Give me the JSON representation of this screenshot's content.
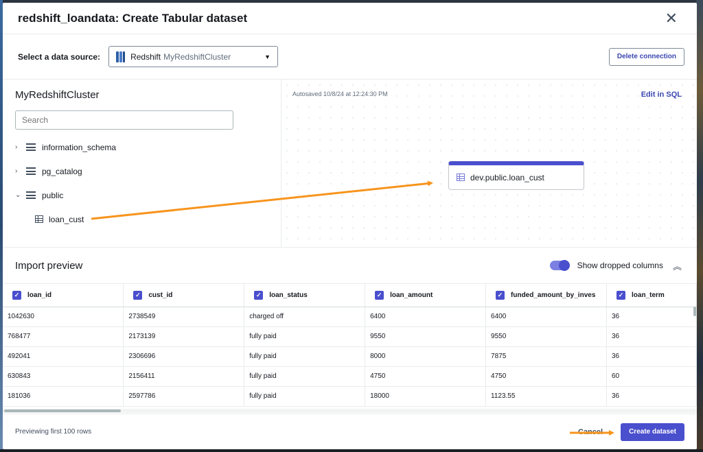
{
  "dialog": {
    "title": "redshift_loandata: Create Tabular dataset",
    "close_symbol": "✕"
  },
  "source": {
    "label": "Select a data source:",
    "selected_name": "Redshift",
    "selected_cluster": "MyRedshiftCluster",
    "delete_label": "Delete connection"
  },
  "explorer": {
    "cluster_title": "MyRedshiftCluster",
    "search_placeholder": "Search",
    "schemas": [
      {
        "label": "information_schema",
        "expanded": false
      },
      {
        "label": "pg_catalog",
        "expanded": false
      },
      {
        "label": "public",
        "expanded": true
      }
    ],
    "tables": [
      {
        "label": "loan_cust"
      }
    ]
  },
  "canvas": {
    "autosave": "Autosaved 10/8/24 at 12:24:30 PM",
    "edit_sql": "Edit in SQL",
    "node_label": "dev.public.loan_cust"
  },
  "preview": {
    "title": "Import preview",
    "toggle_label": "Show dropped columns",
    "toggle_on": true,
    "columns": [
      "loan_id",
      "cust_id",
      "loan_status",
      "loan_amount",
      "funded_amount_by_inves",
      "loan_term"
    ],
    "rows": [
      [
        "1042630",
        "2738549",
        "charged off",
        "6400",
        "6400",
        "36"
      ],
      [
        "768477",
        "2173139",
        "fully paid",
        "9550",
        "9550",
        "36"
      ],
      [
        "492041",
        "2306696",
        "fully paid",
        "8000",
        "7875",
        "36"
      ],
      [
        "630843",
        "2156411",
        "fully paid",
        "4750",
        "4750",
        "60"
      ],
      [
        "181036",
        "2597786",
        "fully paid",
        "18000",
        "1123.55",
        "36"
      ]
    ]
  },
  "footer": {
    "note": "Previewing first 100 rows",
    "cancel_label": "Cancel",
    "create_label": "Create dataset"
  },
  "colors": {
    "accent": "#4a4fcd",
    "link": "#3a46b0",
    "annotation_arrow": "#f7941d"
  }
}
